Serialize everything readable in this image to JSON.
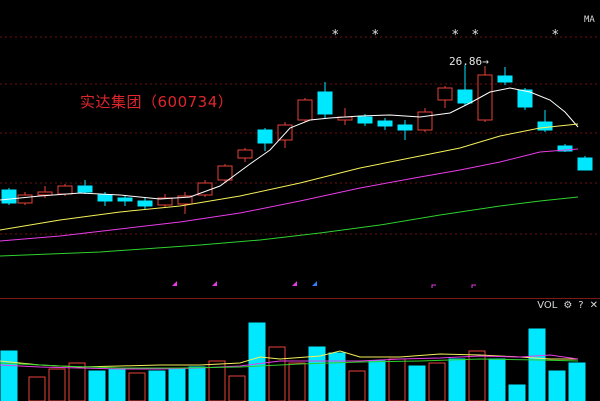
{
  "stock": {
    "name_label": "实达集团（600734）"
  },
  "price_panel": {
    "ma_label": "MA",
    "high_marker_label": "26.86→",
    "star_symbol": "*",
    "colors": {
      "up": "#e8423a",
      "down": "#00e8ff",
      "ma_white": "#ffffff",
      "ma_yellow": "#f5f05a",
      "ma_magenta": "#e83ce8",
      "ma_green": "#2ed12e",
      "grid": "#6b0f0f"
    }
  },
  "volume_panel": {
    "label": "VOL",
    "gear_icon": "⚙",
    "help_icon": "?",
    "close_icon": "✕"
  }
}
